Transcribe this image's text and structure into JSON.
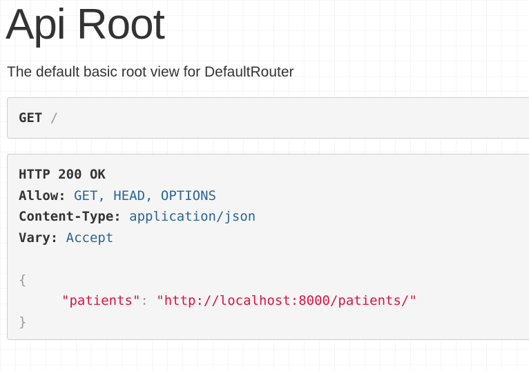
{
  "page": {
    "title": "Api Root",
    "description": "The default basic root view for DefaultRouter"
  },
  "request": {
    "method": "GET",
    "path": "/"
  },
  "response": {
    "status": "HTTP 200 OK",
    "headers": [
      {
        "name": "Allow:",
        "value": "GET, HEAD, OPTIONS"
      },
      {
        "name": "Content-Type:",
        "value": "application/json"
      },
      {
        "name": "Vary:",
        "value": "Accept"
      }
    ],
    "body": {
      "open_brace": "{",
      "close_brace": "}",
      "entries": [
        {
          "key": "\"patients\"",
          "separator": ":",
          "value": "\"http://localhost:8000/patients/\""
        }
      ]
    }
  },
  "colors": {
    "link": "#2a6496",
    "json_string": "#dd1144",
    "muted": "#999999",
    "panel_bg": "#f5f5f5",
    "panel_border": "#cccccc"
  }
}
